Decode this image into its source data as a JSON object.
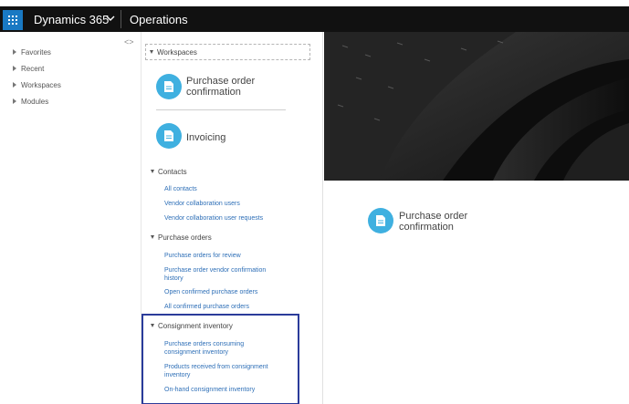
{
  "topbar": {
    "app_name": "Dynamics 365",
    "module_name": "Operations"
  },
  "nav": {
    "items": [
      {
        "label": "Favorites"
      },
      {
        "label": "Recent"
      },
      {
        "label": "Workspaces"
      },
      {
        "label": "Modules"
      }
    ]
  },
  "flyout": {
    "workspaces_header": "Workspaces",
    "tiles": [
      {
        "label_line1": "Purchase order",
        "label_line2": "confirmation"
      },
      {
        "label_line1": "Invoicing"
      }
    ],
    "sections": [
      {
        "title": "Contacts",
        "links": [
          {
            "line1": "All contacts"
          },
          {
            "line1": "Vendor collaboration users"
          },
          {
            "line1": "Vendor collaboration user requests"
          }
        ]
      },
      {
        "title": "Purchase orders",
        "links": [
          {
            "line1": "Purchase orders for review"
          },
          {
            "line1": "Purchase order vendor confirmation",
            "line2": "history"
          },
          {
            "line1": "Open confirmed purchase orders"
          },
          {
            "line1": "All confirmed purchase orders"
          }
        ]
      },
      {
        "title": "Consignment inventory",
        "links": [
          {
            "line1": "Purchase orders consuming",
            "line2": "consignment inventory"
          },
          {
            "line1": "Products received from consignment",
            "line2": "inventory"
          },
          {
            "line1": "On-hand consignment inventory"
          }
        ]
      }
    ]
  },
  "main": {
    "tile": {
      "label_line1": "Purchase order",
      "label_line2": "confirmation"
    }
  },
  "colors": {
    "topbar": "#111111",
    "waffle": "#1979c3",
    "tile_circle": "#3fb0e0",
    "link": "#2e6fb7",
    "highlight_border": "#2b3c9a"
  }
}
